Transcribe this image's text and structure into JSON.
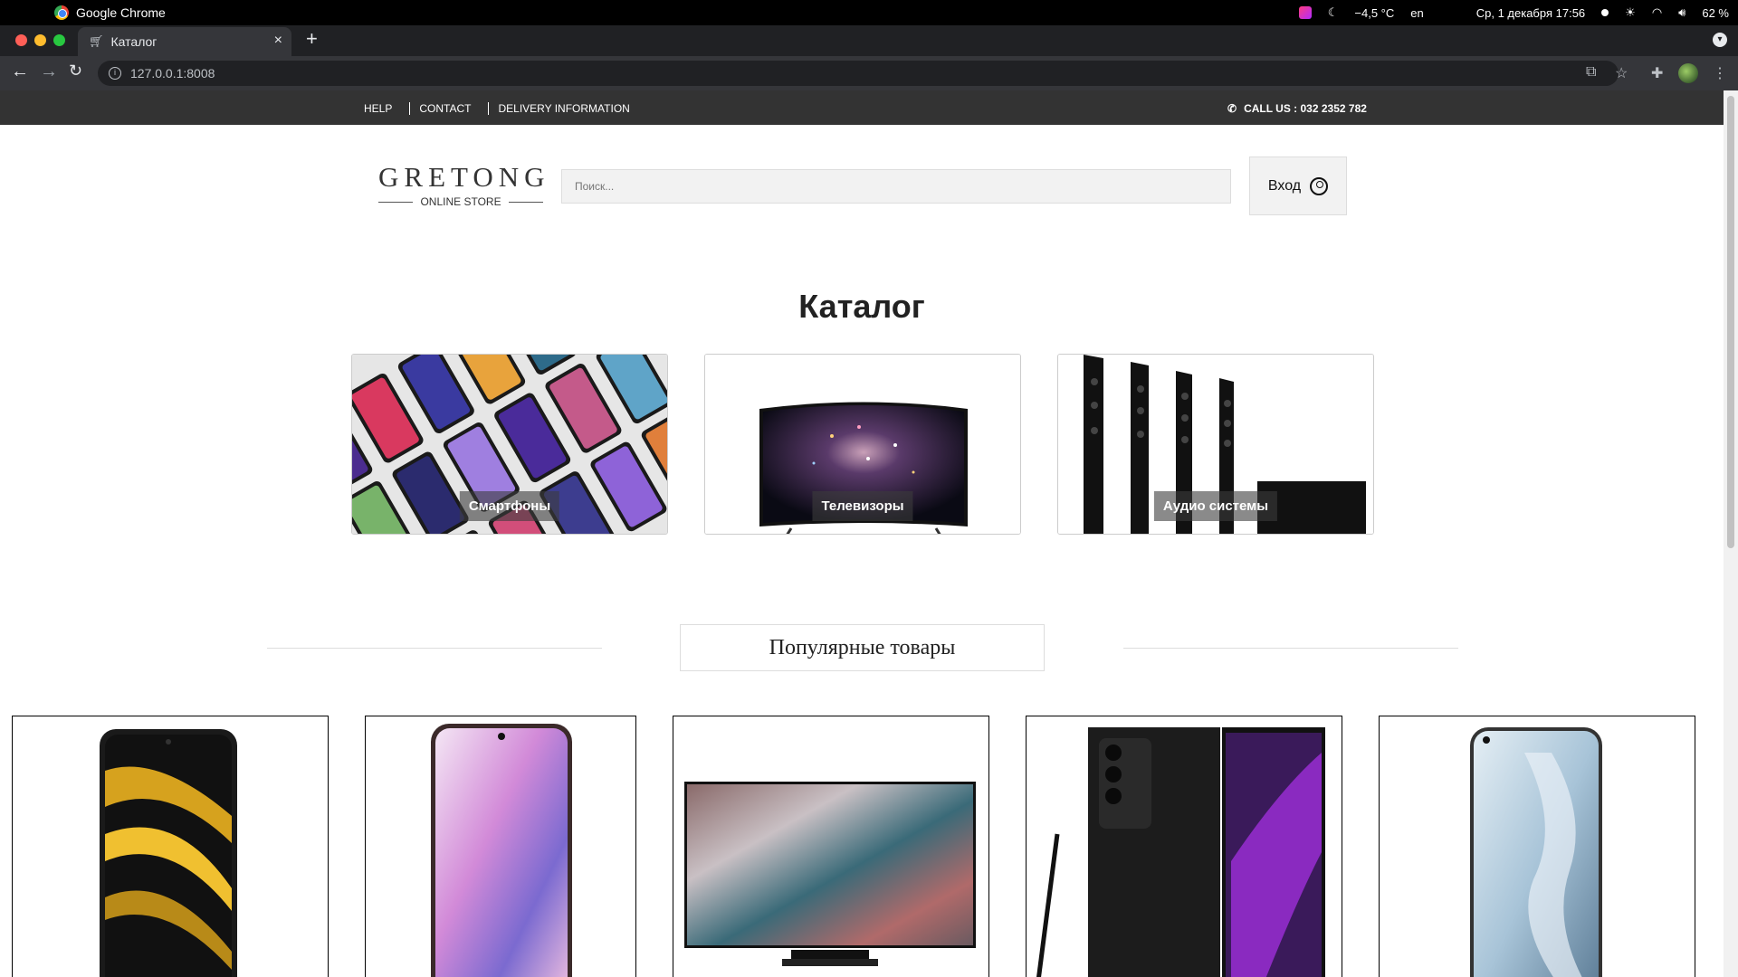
{
  "os": {
    "app_name": "Google Chrome",
    "weather": "−4,5 °C",
    "lang": "en",
    "datetime": "Ср, 1 декабря  17:56",
    "battery": "62 %"
  },
  "browser": {
    "tab_title": "Каталог",
    "url": "127.0.0.1:8008"
  },
  "site": {
    "topnav": {
      "help": "HELP",
      "contact": "CONTACT",
      "delivery": "DELIVERY INFORMATION",
      "call": "CALL US : 032 2352 782"
    },
    "logo": {
      "name": "GRETONG",
      "sub": "ONLINE STORE"
    },
    "search": {
      "placeholder": "Поиск..."
    },
    "login_label": "Вход",
    "catalog_title": "Каталог",
    "categories": [
      {
        "label": "Смартфоны"
      },
      {
        "label": "Телевизоры"
      },
      {
        "label": "Аудио системы"
      }
    ],
    "popular_title": "Популярные товары"
  },
  "colors": {
    "topnav_bg": "#333333",
    "search_bg": "#f2f2f2"
  }
}
